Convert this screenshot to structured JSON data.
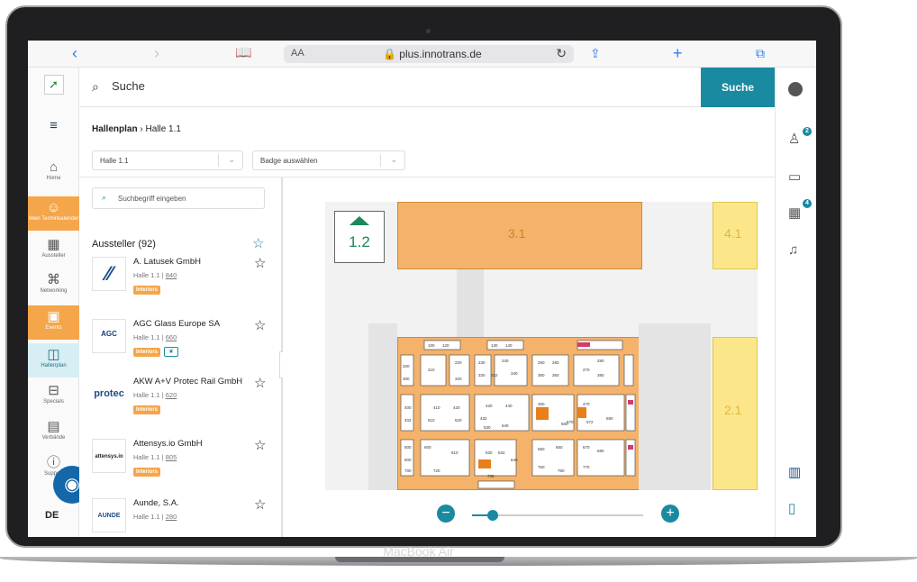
{
  "device": {
    "label": "MacBook Air"
  },
  "browser": {
    "reader_label": "AA",
    "url": "plus.innotrans.de",
    "lock_icon": "lock-icon"
  },
  "search": {
    "label": "Suche",
    "button": "Suche",
    "placeholder": "Suchbegriff eingeben"
  },
  "nav": {
    "items": [
      {
        "label": "Home",
        "icon": "home-icon"
      },
      {
        "label": "Mein Terminkalender",
        "icon": "calendar-people-icon"
      },
      {
        "label": "Aussteller",
        "icon": "grid-icon"
      },
      {
        "label": "Networking",
        "icon": "network-icon"
      },
      {
        "label": "Events",
        "icon": "event-icon"
      },
      {
        "label": "Hallenplan",
        "icon": "map-icon"
      },
      {
        "label": "Specials",
        "icon": "specials-icon"
      },
      {
        "label": "Verbände",
        "icon": "building-icon"
      },
      {
        "label": "Support",
        "icon": "help-icon"
      }
    ],
    "language": "DE"
  },
  "breadcrumb": {
    "root": "Hallenplan",
    "current": "Halle 1.1"
  },
  "filters": {
    "hall": "Halle 1.1",
    "badge": "Badge auswählen"
  },
  "exhibitors": {
    "title": "Aussteller (92)",
    "items": [
      {
        "name": "A. Latusek GmbH",
        "hall": "Halle 1.1",
        "booth": "840",
        "tag": "Interiors",
        "logo": ""
      },
      {
        "name": "AGC Glass Europe SA",
        "hall": "Halle 1.1",
        "booth": "660",
        "tag": "Interiors",
        "logo": "AGC"
      },
      {
        "name": "AKW A+V Protec Rail GmbH",
        "hall": "Halle 1.1",
        "booth": "620",
        "tag": "Interiors",
        "logo": "protec"
      },
      {
        "name": "Attensys.io GmbH",
        "hall": "Halle 1.1",
        "booth": "805",
        "tag": "Interiors",
        "logo": "attensys.io"
      },
      {
        "name": "Aunde, S.A.",
        "hall": "Halle 1.1",
        "booth": "280",
        "tag": "",
        "logo": "AUNDE"
      }
    ]
  },
  "map": {
    "halls": [
      "1.2",
      "3.1",
      "4.1",
      "2.1"
    ],
    "booths": [
      "100",
      "120",
      "130",
      "140",
      "200",
      "210",
      "220",
      "230",
      "240",
      "250",
      "260",
      "270",
      "280",
      "300",
      "310",
      "320",
      "330",
      "332",
      "340",
      "350",
      "360",
      "400",
      "402",
      "410",
      "420",
      "430",
      "432",
      "440",
      "450",
      "470",
      "500",
      "510",
      "520",
      "530",
      "540",
      "560",
      "570",
      "572",
      "580",
      "600",
      "610",
      "620",
      "630",
      "632",
      "640",
      "650",
      "660",
      "670",
      "680",
      "700",
      "720",
      "730",
      "750",
      "770"
    ]
  },
  "right_nav": {
    "contacts_badge": "2",
    "calendar_badge": "4"
  },
  "colors": {
    "accent": "#1a8aa0",
    "hall_orange": "#f5a54a",
    "hall_yellow": "#fbe789"
  }
}
